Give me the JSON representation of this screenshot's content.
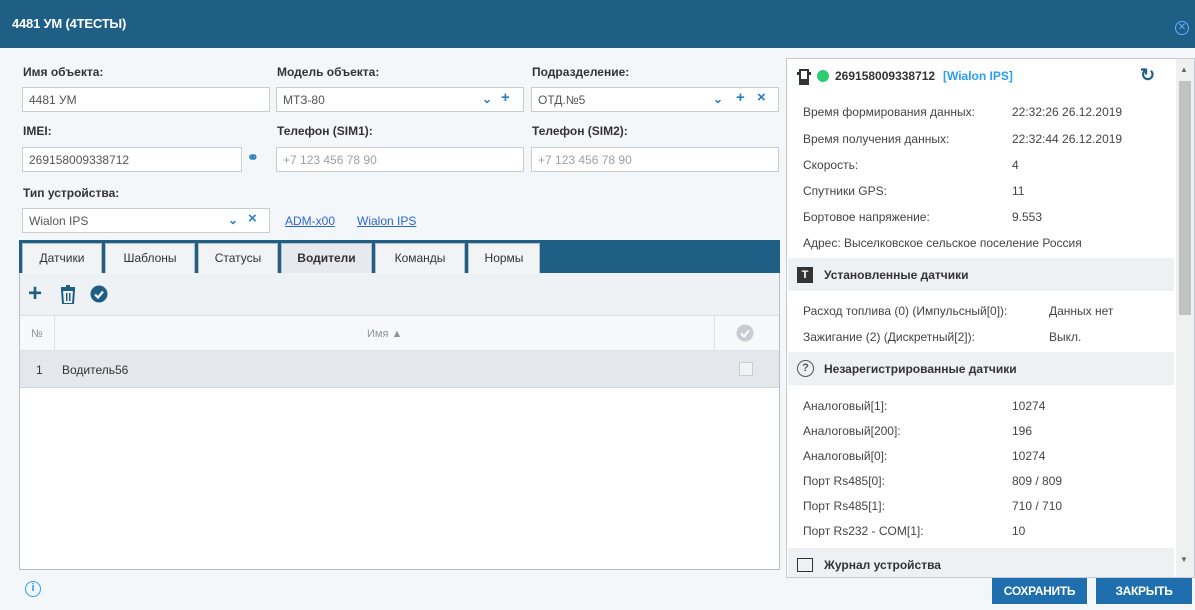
{
  "window": {
    "title": "4481 УМ (4ТЕСТЫ)"
  },
  "form": {
    "object_name_label": "Имя объекта:",
    "object_name_value": "4481 УМ",
    "model_label": "Модель объекта:",
    "model_value": "МТЗ-80",
    "division_label": "Подразделение:",
    "division_value": "ОТД.№5",
    "imei_label": "IMEI:",
    "imei_value": "269158009338712",
    "phone1_label": "Телефон (SIM1):",
    "phone1_placeholder": "+7 123 456 78 90",
    "phone2_label": "Телефон (SIM2):",
    "phone2_placeholder": "+7 123 456 78 90",
    "device_type_label": "Тип устройства:",
    "device_type_value": "Wialon IPS",
    "link_adm": "ADM-x00",
    "link_wialon": "Wialon IPS"
  },
  "tabs": [
    "Датчики",
    "Шаблоны",
    "Статусы",
    "Водители",
    "Команды",
    "Нормы"
  ],
  "active_tab": "Водители",
  "table": {
    "col_num": "№",
    "col_name": "Имя ▲",
    "rows": [
      {
        "num": "1",
        "name": "Водитель56"
      }
    ]
  },
  "info": {
    "device_id": "269158009338712",
    "protocol": "[Wialon IPS]",
    "status_color": "#2ecc71",
    "fields": [
      {
        "label": "Время формирования данных:",
        "value": "22:32:26 26.12.2019"
      },
      {
        "label": "Время получения данных:",
        "value": "22:32:44 26.12.2019"
      },
      {
        "label": "Скорость:",
        "value": "4"
      },
      {
        "label": "Спутники GPS:",
        "value": "11"
      },
      {
        "label": "Бортовое напряжение:",
        "value": "9.553"
      }
    ],
    "address": "Адрес: Выселковское сельское поселение Россия",
    "installed_title": "Установленные датчики",
    "installed": [
      {
        "label": "Расход топлива (0) (Импульсный[0]):",
        "value": "Данных нет"
      },
      {
        "label": "Зажигание (2) (Дискретный[2]):",
        "value": "Выкл."
      }
    ],
    "unregistered_title": "Незарегистрированные датчики",
    "unregistered": [
      {
        "label": "Аналоговый[1]:",
        "value": "10274"
      },
      {
        "label": "Аналоговый[200]:",
        "value": "196"
      },
      {
        "label": "Аналоговый[0]:",
        "value": "10274"
      },
      {
        "label": "Порт Rs485[0]:",
        "value": "809 / 809"
      },
      {
        "label": "Порт Rs485[1]:",
        "value": "710 / 710"
      },
      {
        "label": "Порт Rs232 - COM[1]:",
        "value": "10"
      }
    ],
    "journal_title": "Журнал устройства"
  },
  "buttons": {
    "save": "СОХРАНИТЬ",
    "close": "ЗАКРЫТЬ"
  },
  "colors": {
    "titlebar": "#1f5f86",
    "accent": "#2a7fc0",
    "button": "#1f6fae"
  }
}
